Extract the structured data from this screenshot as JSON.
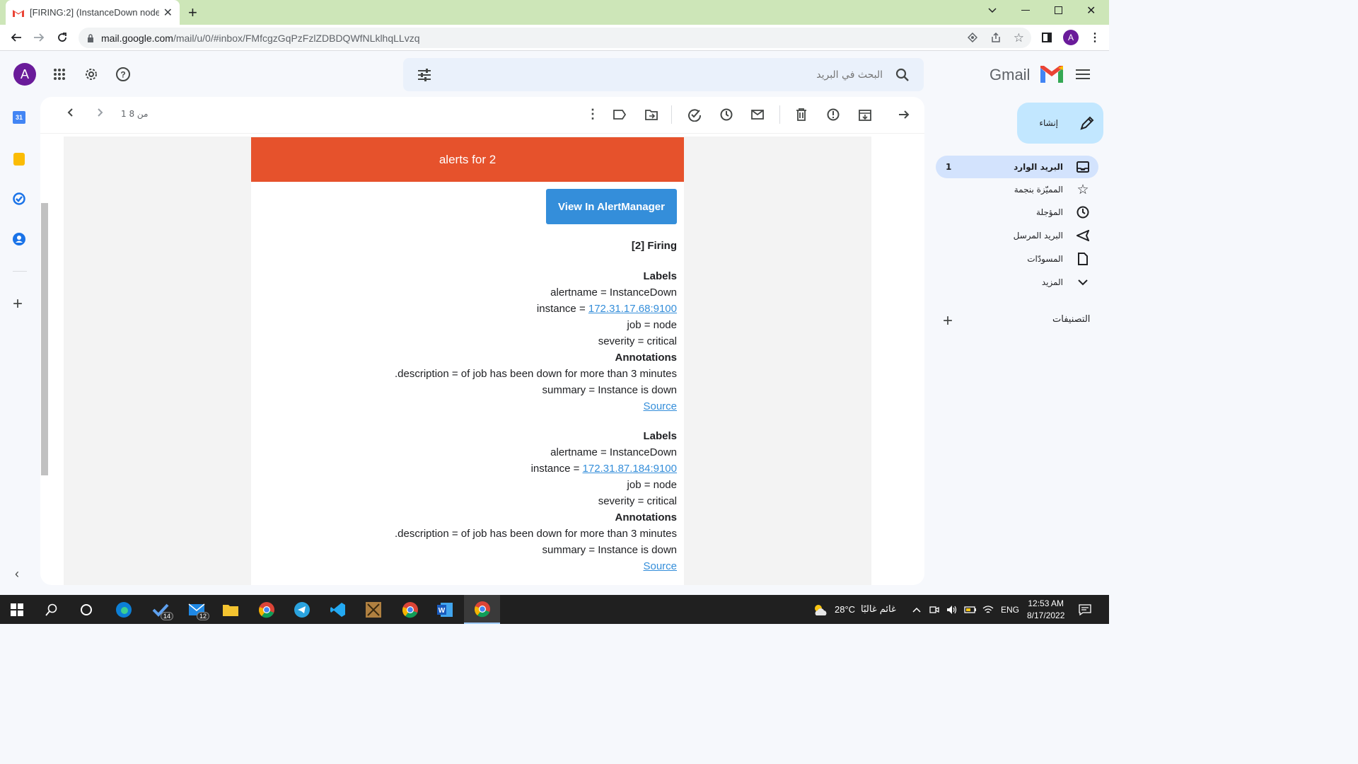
{
  "browser": {
    "tab_title": "[FIRING:2] (InstanceDown node c",
    "url_host": "mail.google.com",
    "url_path": "/mail/u/0/#inbox/FMfcgzGqPzFzlZDBDQWfNLklhqLLvzq",
    "profile_initial": "A"
  },
  "gmail": {
    "logo_text": "Gmail",
    "search_placeholder": "البحث في البريد",
    "account_initial": "A",
    "pagination": "1 من 8",
    "compose_label": "إنشاء",
    "labels_header": "التصنيفات",
    "nav": [
      {
        "label": "البريد الوارد",
        "icon": "inbox-icon",
        "count": "1",
        "active": true
      },
      {
        "label": "المميّزة بنجمة",
        "icon": "star-icon",
        "count": "",
        "active": false
      },
      {
        "label": "المؤجلة",
        "icon": "clock-icon",
        "count": "",
        "active": false
      },
      {
        "label": "البريد المرسل",
        "icon": "send-icon",
        "count": "",
        "active": false
      },
      {
        "label": "المسودّات",
        "icon": "draft-icon",
        "count": "",
        "active": false
      },
      {
        "label": "المزيد",
        "icon": "chevron-down-icon",
        "count": "",
        "active": false
      }
    ]
  },
  "email": {
    "banner": "alerts for 2",
    "view_button": "View In AlertManager",
    "firing": "[2] Firing",
    "alerts": [
      {
        "labels_heading": "Labels",
        "alertname": "alertname = InstanceDown",
        "instance_prefix": "instance = ",
        "instance_link": "172.31.17.68:9100",
        "job": "job = node",
        "severity": "severity = critical",
        "annotations_heading": "Annotations",
        "description": "description = of job has been down for more than 3 minutes.",
        "summary": "summary = Instance is down",
        "source": "Source"
      },
      {
        "labels_heading": "Labels",
        "alertname": "alertname = InstanceDown",
        "instance_prefix": "instance = ",
        "instance_link": "172.31.87.184:9100",
        "job": "job = node",
        "severity": "severity = critical",
        "annotations_heading": "Annotations",
        "description": "description = of job has been down for more than 3 minutes.",
        "summary": "summary = Instance is down",
        "source": "Source"
      }
    ]
  },
  "taskbar": {
    "weather_temp": "28°C",
    "weather_text": "غائم غالبًا",
    "language": "ENG",
    "time": "12:53 AM",
    "date": "8/17/2022",
    "todo_badge": "14",
    "mail_badge": "12"
  },
  "colors": {
    "banner": "#e6522c",
    "button": "#348eda",
    "compose": "#c2e7ff",
    "active_nav": "#d3e3fd"
  }
}
